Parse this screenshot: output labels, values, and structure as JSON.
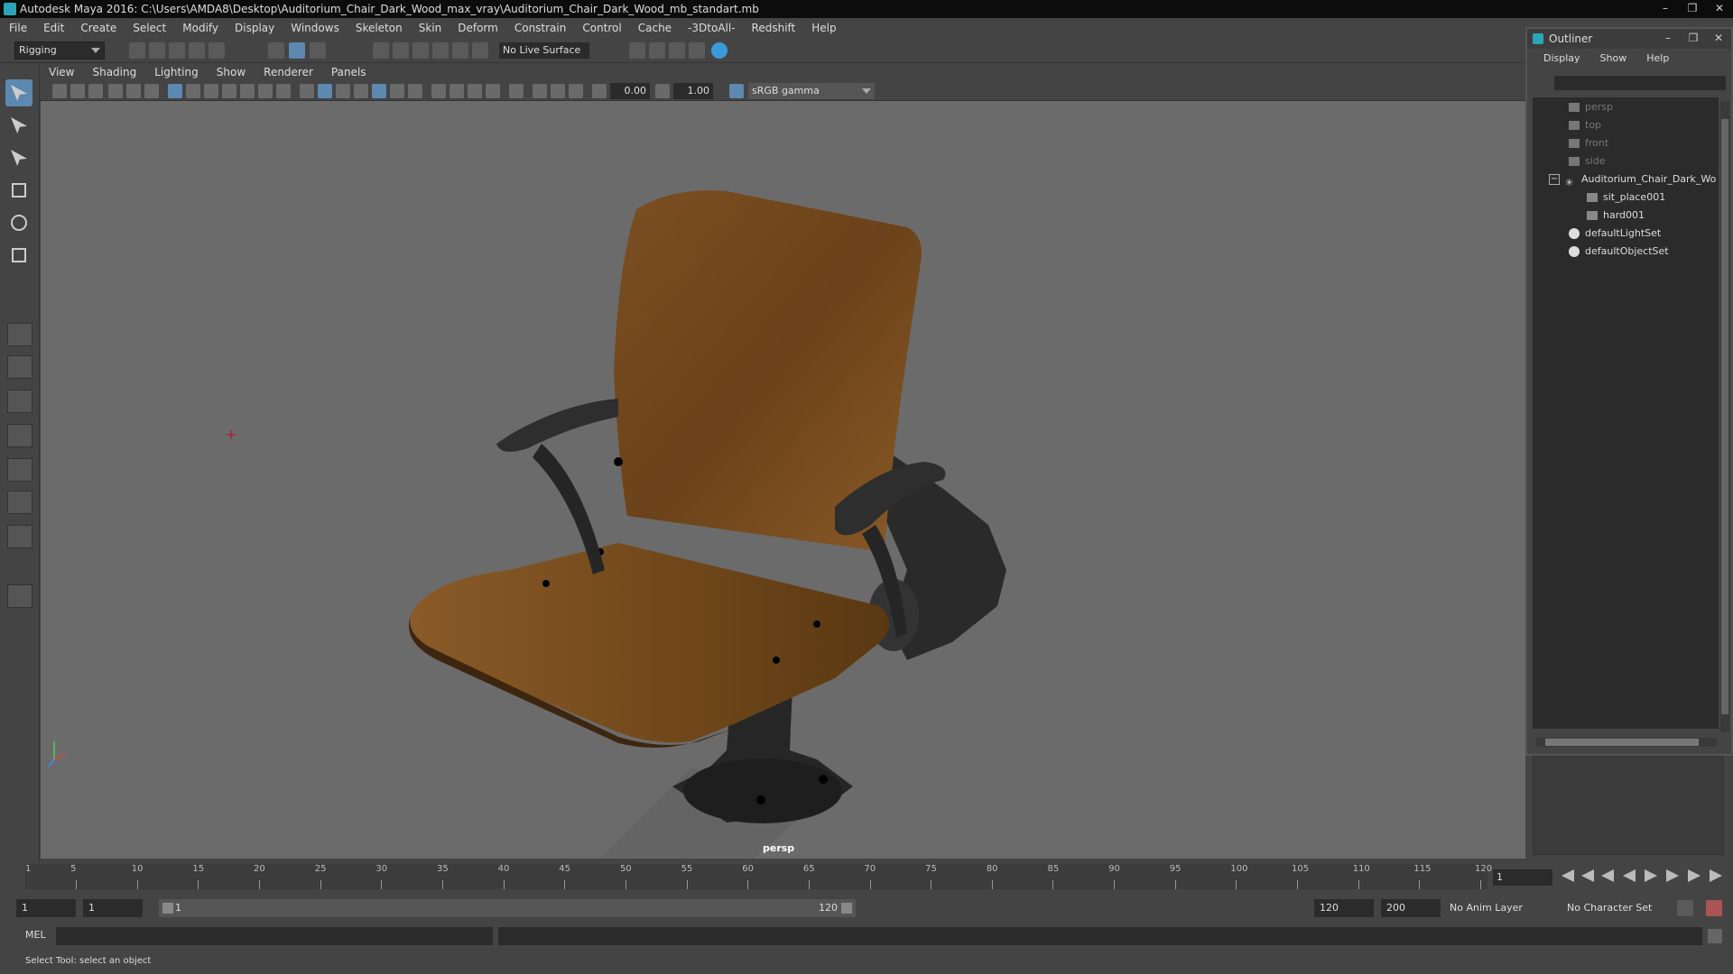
{
  "window": {
    "title": "Autodesk Maya 2016: C:\\Users\\AMDA8\\Desktop\\Auditorium_Chair_Dark_Wood_max_vray\\Auditorium_Chair_Dark_Wood_mb_standart.mb",
    "controls": [
      "–",
      "❐",
      "✕"
    ]
  },
  "menubar": [
    "File",
    "Edit",
    "Create",
    "Select",
    "Modify",
    "Display",
    "Windows",
    "Skeleton",
    "Skin",
    "Deform",
    "Constrain",
    "Control",
    "Cache",
    "-3DtoAll-",
    "Redshift",
    "Help"
  ],
  "shelf": {
    "mode": "Rigging",
    "live_surface": "No Live Surface"
  },
  "viewport": {
    "menu": [
      "View",
      "Shading",
      "Lighting",
      "Show",
      "Renderer",
      "Panels"
    ],
    "exposure": "0.00",
    "gamma": "1.00",
    "colorspace": "sRGB gamma",
    "camera_label": "persp"
  },
  "outliner": {
    "title": "Outliner",
    "menu": [
      "Display",
      "Show",
      "Help"
    ],
    "items": [
      {
        "label": "persp",
        "type": "camera"
      },
      {
        "label": "top",
        "type": "camera"
      },
      {
        "label": "front",
        "type": "camera"
      },
      {
        "label": "side",
        "type": "camera"
      },
      {
        "label": "Auditorium_Chair_Dark_Wo",
        "type": "group"
      },
      {
        "label": "sit_place001",
        "type": "mesh"
      },
      {
        "label": "hard001",
        "type": "mesh"
      },
      {
        "label": "defaultLightSet",
        "type": "set"
      },
      {
        "label": "defaultObjectSet",
        "type": "set"
      }
    ]
  },
  "timeline": {
    "ticks": [
      "5",
      "10",
      "15",
      "20",
      "25",
      "30",
      "35",
      "40",
      "45",
      "50",
      "55",
      "60",
      "65",
      "70",
      "75",
      "80",
      "85",
      "90",
      "95",
      "100",
      "105",
      "110",
      "115",
      "120"
    ],
    "start_marker": "1",
    "current_frame": "1"
  },
  "range": {
    "start": "1",
    "anim_start": "1",
    "slider_start": "1",
    "slider_end": "120",
    "anim_end": "120",
    "end": "200",
    "anim_layer": "No Anim Layer",
    "character_set": "No Character Set"
  },
  "cmdline": {
    "label": "MEL"
  },
  "helpline": {
    "text": "Select Tool: select an object"
  }
}
